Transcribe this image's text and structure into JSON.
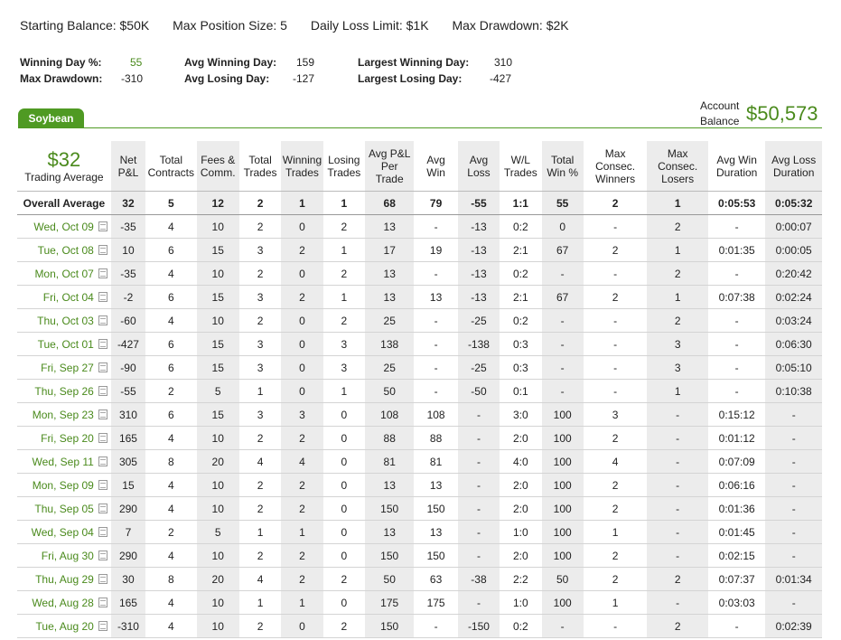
{
  "settings": {
    "starting_balance": "Starting Balance: $50K",
    "max_position": "Max Position Size: 5",
    "daily_loss": "Daily Loss Limit: $1K",
    "max_drawdown": "Max Drawdown: $2K"
  },
  "stats": {
    "winning_day_pct": {
      "label": "Winning Day %:",
      "value": "55"
    },
    "max_drawdown": {
      "label": "Max Drawdown:",
      "value": "-310"
    },
    "avg_winning_day": {
      "label": "Avg Winning Day:",
      "value": "159"
    },
    "avg_losing_day": {
      "label": "Avg Losing Day:",
      "value": "-127"
    },
    "largest_winning_day": {
      "label": "Largest Winning Day:",
      "value": "310"
    },
    "largest_losing_day": {
      "label": "Largest Losing Day:",
      "value": "-427"
    }
  },
  "tab": {
    "label": "Soybean"
  },
  "account": {
    "label_1": "Account",
    "label_2": "Balance",
    "value": "$50,573"
  },
  "summary": {
    "value": "$32",
    "label": "Trading Average"
  },
  "table": {
    "columns": [
      [
        "Net",
        "P&L"
      ],
      [
        "Total",
        "Contracts"
      ],
      [
        "Fees &",
        "Comm."
      ],
      [
        "Total",
        "Trades"
      ],
      [
        "Winning",
        "Trades"
      ],
      [
        "Losing",
        "Trades"
      ],
      [
        "Avg P&L",
        "Per",
        "Trade"
      ],
      [
        "Avg",
        "Win"
      ],
      [
        "Avg",
        "Loss"
      ],
      [
        "W/L",
        "Trades"
      ],
      [
        "Total",
        "Win %"
      ],
      [
        "Max Consec.",
        "Winners"
      ],
      [
        "Max Consec.",
        "Losers"
      ],
      [
        "Avg Win",
        "Duration"
      ],
      [
        "Avg Loss",
        "Duration"
      ]
    ],
    "average_row": {
      "label": "Overall Average",
      "values": [
        "32",
        "5",
        "12",
        "2",
        "1",
        "1",
        "68",
        "79",
        "-55",
        "1:1",
        "55",
        "2",
        "1",
        "0:05:53",
        "0:05:32"
      ]
    },
    "rows": [
      {
        "date": "Wed, Oct 09",
        "values": [
          "-35",
          "4",
          "10",
          "2",
          "0",
          "2",
          "13",
          "-",
          "-13",
          "0:2",
          "0",
          "-",
          "2",
          "-",
          "0:00:07"
        ]
      },
      {
        "date": "Tue, Oct 08",
        "values": [
          "10",
          "6",
          "15",
          "3",
          "2",
          "1",
          "17",
          "19",
          "-13",
          "2:1",
          "67",
          "2",
          "1",
          "0:01:35",
          "0:00:05"
        ]
      },
      {
        "date": "Mon, Oct 07",
        "values": [
          "-35",
          "4",
          "10",
          "2",
          "0",
          "2",
          "13",
          "-",
          "-13",
          "0:2",
          "-",
          "-",
          "2",
          "-",
          "0:20:42"
        ]
      },
      {
        "date": "Fri, Oct 04",
        "values": [
          "-2",
          "6",
          "15",
          "3",
          "2",
          "1",
          "13",
          "13",
          "-13",
          "2:1",
          "67",
          "2",
          "1",
          "0:07:38",
          "0:02:24"
        ]
      },
      {
        "date": "Thu, Oct 03",
        "values": [
          "-60",
          "4",
          "10",
          "2",
          "0",
          "2",
          "25",
          "-",
          "-25",
          "0:2",
          "-",
          "-",
          "2",
          "-",
          "0:03:24"
        ]
      },
      {
        "date": "Tue, Oct 01",
        "values": [
          "-427",
          "6",
          "15",
          "3",
          "0",
          "3",
          "138",
          "-",
          "-138",
          "0:3",
          "-",
          "-",
          "3",
          "-",
          "0:06:30"
        ]
      },
      {
        "date": "Fri, Sep 27",
        "values": [
          "-90",
          "6",
          "15",
          "3",
          "0",
          "3",
          "25",
          "-",
          "-25",
          "0:3",
          "-",
          "-",
          "3",
          "-",
          "0:05:10"
        ]
      },
      {
        "date": "Thu, Sep 26",
        "values": [
          "-55",
          "2",
          "5",
          "1",
          "0",
          "1",
          "50",
          "-",
          "-50",
          "0:1",
          "-",
          "-",
          "1",
          "-",
          "0:10:38"
        ]
      },
      {
        "date": "Mon, Sep 23",
        "values": [
          "310",
          "6",
          "15",
          "3",
          "3",
          "0",
          "108",
          "108",
          "-",
          "3:0",
          "100",
          "3",
          "-",
          "0:15:12",
          "-"
        ]
      },
      {
        "date": "Fri, Sep 20",
        "values": [
          "165",
          "4",
          "10",
          "2",
          "2",
          "0",
          "88",
          "88",
          "-",
          "2:0",
          "100",
          "2",
          "-",
          "0:01:12",
          "-"
        ]
      },
      {
        "date": "Wed, Sep 11",
        "values": [
          "305",
          "8",
          "20",
          "4",
          "4",
          "0",
          "81",
          "81",
          "-",
          "4:0",
          "100",
          "4",
          "-",
          "0:07:09",
          "-"
        ]
      },
      {
        "date": "Mon, Sep 09",
        "values": [
          "15",
          "4",
          "10",
          "2",
          "2",
          "0",
          "13",
          "13",
          "-",
          "2:0",
          "100",
          "2",
          "-",
          "0:06:16",
          "-"
        ]
      },
      {
        "date": "Thu, Sep 05",
        "values": [
          "290",
          "4",
          "10",
          "2",
          "2",
          "0",
          "150",
          "150",
          "-",
          "2:0",
          "100",
          "2",
          "-",
          "0:01:36",
          "-"
        ]
      },
      {
        "date": "Wed, Sep 04",
        "values": [
          "7",
          "2",
          "5",
          "1",
          "1",
          "0",
          "13",
          "13",
          "-",
          "1:0",
          "100",
          "1",
          "-",
          "0:01:45",
          "-"
        ]
      },
      {
        "date": "Fri, Aug 30",
        "values": [
          "290",
          "4",
          "10",
          "2",
          "2",
          "0",
          "150",
          "150",
          "-",
          "2:0",
          "100",
          "2",
          "-",
          "0:02:15",
          "-"
        ]
      },
      {
        "date": "Thu, Aug 29",
        "values": [
          "30",
          "8",
          "20",
          "4",
          "2",
          "2",
          "50",
          "63",
          "-38",
          "2:2",
          "50",
          "2",
          "2",
          "0:07:37",
          "0:01:34"
        ]
      },
      {
        "date": "Wed, Aug 28",
        "values": [
          "165",
          "4",
          "10",
          "1",
          "1",
          "0",
          "175",
          "175",
          "-",
          "1:0",
          "100",
          "1",
          "-",
          "0:03:03",
          "-"
        ]
      },
      {
        "date": "Tue, Aug 20",
        "values": [
          "-310",
          "4",
          "10",
          "2",
          "0",
          "2",
          "150",
          "-",
          "-150",
          "0:2",
          "-",
          "-",
          "2",
          "-",
          "0:02:39"
        ]
      }
    ]
  }
}
